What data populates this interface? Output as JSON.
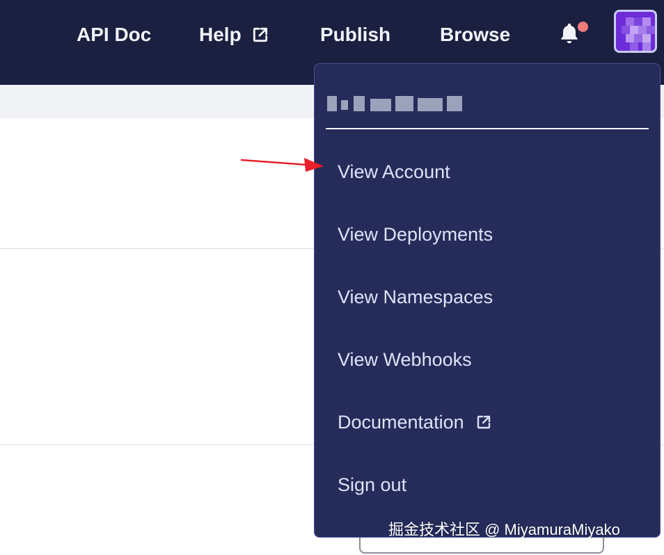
{
  "navbar": {
    "links": [
      "API Doc",
      "Help",
      "Publish",
      "Browse"
    ],
    "help_icon": "external-link-icon",
    "notification_icon": "bell-icon",
    "notification_dot_color": "#f07b7b",
    "avatar_icon": "pixelated-avatar",
    "background_color": "#1b2040"
  },
  "user_menu": {
    "items": [
      "View Account",
      "View Deployments",
      "View Namespaces",
      "View Webhooks",
      "Documentation",
      "Sign out"
    ],
    "documentation_icon": "external-link-icon",
    "background_color": "#252c5a"
  },
  "annotation": {
    "arrow_color": "#e8202a"
  },
  "watermark": "掘金技术社区 @ MiyamuraMiyako"
}
